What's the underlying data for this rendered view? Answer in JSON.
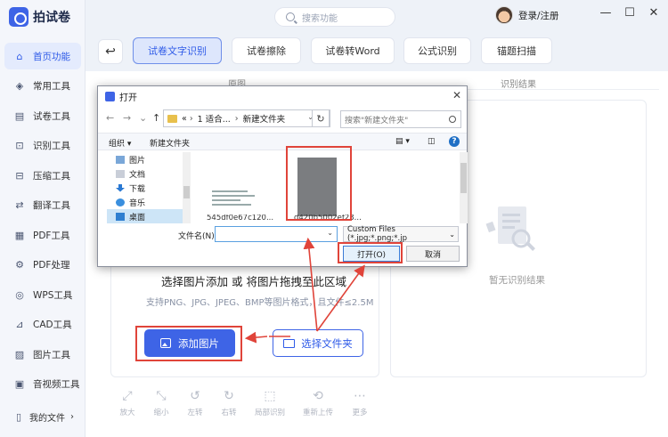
{
  "app": {
    "name": "拍试卷"
  },
  "search": {
    "placeholder": "搜索功能"
  },
  "user": {
    "login": "登录/注册"
  },
  "window": {
    "minimize": "—",
    "restore": "☐",
    "close": "✕"
  },
  "sidebar": {
    "items": [
      {
        "label": "首页功能",
        "icon": "home-icon",
        "glyph": "⌂"
      },
      {
        "label": "常用工具",
        "icon": "layers-icon",
        "glyph": "◈"
      },
      {
        "label": "试卷工具",
        "icon": "paper-icon",
        "glyph": "▤"
      },
      {
        "label": "识别工具",
        "icon": "scan-icon",
        "glyph": "⊡"
      },
      {
        "label": "压缩工具",
        "icon": "compress-icon",
        "glyph": "⊟"
      },
      {
        "label": "翻译工具",
        "icon": "translate-icon",
        "glyph": "⇄"
      },
      {
        "label": "PDF工具",
        "icon": "pdf-icon",
        "glyph": "▦"
      },
      {
        "label": "PDF处理",
        "icon": "pdf-process-icon",
        "glyph": "⚙"
      },
      {
        "label": "WPS工具",
        "icon": "wps-icon",
        "glyph": "◎"
      },
      {
        "label": "CAD工具",
        "icon": "cad-icon",
        "glyph": "⊿"
      },
      {
        "label": "图片工具",
        "icon": "image-icon",
        "glyph": "▨"
      },
      {
        "label": "音视频工具",
        "icon": "media-icon",
        "glyph": "▣"
      }
    ],
    "my_files": "我的文件",
    "my_files_chevron": "›"
  },
  "back_glyph": "↩",
  "tabs": [
    {
      "label": "试卷文字识别"
    },
    {
      "label": "试卷擦除"
    },
    {
      "label": "试卷转Word"
    },
    {
      "label": "公式识别"
    },
    {
      "label": "锚题扫描"
    }
  ],
  "columns": {
    "original": "原图",
    "result": "识别结果"
  },
  "upload": {
    "main_text": "选择图片添加 或 将图片拖拽至此区域",
    "sub_text": "支持PNG、JPG、JPEG、BMP等图片格式，且文件≤2.5M",
    "add_button": "添加图片",
    "folder_button": "选择文件夹"
  },
  "result": {
    "empty_text": "暂无识别结果"
  },
  "tools": [
    {
      "label": "放大",
      "glyph": "⤢"
    },
    {
      "label": "缩小",
      "glyph": "⤡"
    },
    {
      "label": "左转",
      "glyph": "↺"
    },
    {
      "label": "右转",
      "glyph": "↻"
    },
    {
      "label": "局部识别",
      "glyph": "⬚"
    },
    {
      "label": "重新上传",
      "glyph": "⟲"
    },
    {
      "label": "更多",
      "glyph": "⋯"
    }
  ],
  "dialog": {
    "title": "打开",
    "close": "✕",
    "nav_back": "←",
    "nav_forward": "→",
    "nav_down": "⌄",
    "nav_up": "↑",
    "path": [
      "«",
      "1 适合...",
      "新建文件夹"
    ],
    "path_sep": "›",
    "refresh": "↻",
    "search_placeholder": "搜索\"新建文件夹\"",
    "organize": "组织 ▾",
    "new_folder": "新建文件夹",
    "view_glyph": "▤ ▾",
    "pane_glyph": "◫",
    "help_glyph": "?",
    "tree": [
      {
        "label": "图片",
        "icon": "pictures-icon"
      },
      {
        "label": "文档",
        "icon": "documents-icon"
      },
      {
        "label": "下载",
        "icon": "download-icon"
      },
      {
        "label": "音乐",
        "icon": "music-icon"
      },
      {
        "label": "桌面",
        "icon": "desktop-icon"
      }
    ],
    "files": [
      {
        "name": "545df0e67c120..."
      },
      {
        "name": "d420b5002ef23..."
      }
    ],
    "filename_label": "文件名(N):",
    "filename_value": "",
    "filetype": "Custom Files (*.jpg;*.png;*.jp",
    "open_button": "打开(O)",
    "cancel_button": "取消"
  },
  "colors": {
    "accent": "#3e64e6",
    "highlight": "#e0443a"
  }
}
